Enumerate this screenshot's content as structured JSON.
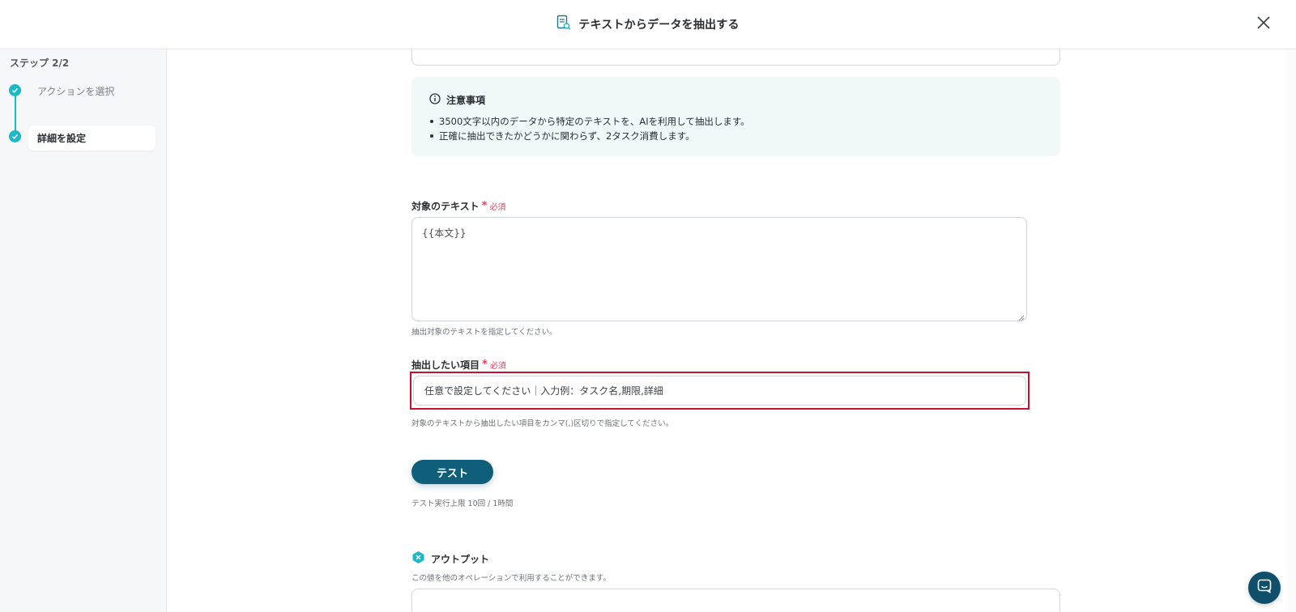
{
  "header": {
    "title": "テキストからデータを抽出する",
    "close_icon": "close-icon",
    "title_icon": "document-search-icon"
  },
  "sidebar": {
    "step_count": "ステップ 2/2",
    "steps": [
      {
        "label": "アクションを選択",
        "status": "completed"
      },
      {
        "label": "詳細を設定",
        "status": "active"
      }
    ]
  },
  "notice": {
    "title": "注意事項",
    "items": [
      "3500文字以内のデータから特定のテキストを、AIを利用して抽出します。",
      "正確に抽出できたかどうかに関わらず、2タスク消費します。"
    ]
  },
  "target_text": {
    "label": "対象のテキスト",
    "required_star": "*",
    "required_text": "必須",
    "value": "{{本文}}",
    "help": "抽出対象のテキストを指定してください。"
  },
  "extract_items": {
    "label": "抽出したい項目",
    "required_star": "*",
    "required_text": "必須",
    "placeholder": "任意で設定してください｜入力例：タスク名,期限,詳細",
    "help": "対象のテキストから抽出したい項目をカンマ(,)区切りで指定してください。"
  },
  "test": {
    "button_label": "テスト",
    "limit_text": "テスト実行上限 10回 / 1時間"
  },
  "output": {
    "title": "アウトプット",
    "description": "この値を他のオペレーションで利用することができます。"
  },
  "colors": {
    "accent": "#1bb8c9",
    "primary_button": "#0f5f7a",
    "required": "#e2405a",
    "highlight_frame": "#c8102e"
  }
}
